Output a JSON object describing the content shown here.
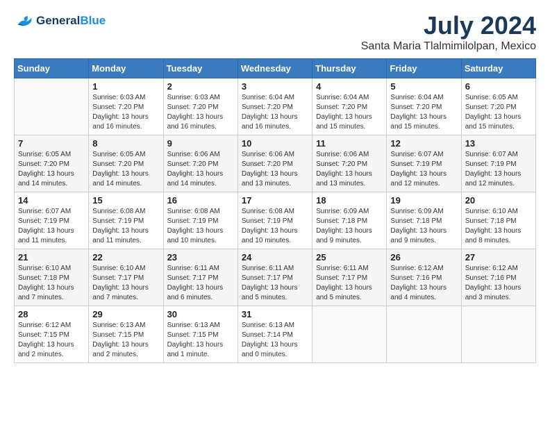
{
  "logo": {
    "line1": "General",
    "line2": "Blue"
  },
  "title": "July 2024",
  "location": "Santa Maria Tlalmimilolpan, Mexico",
  "days_header": [
    "Sunday",
    "Monday",
    "Tuesday",
    "Wednesday",
    "Thursday",
    "Friday",
    "Saturday"
  ],
  "weeks": [
    [
      {
        "day": "",
        "info": ""
      },
      {
        "day": "1",
        "info": "Sunrise: 6:03 AM\nSunset: 7:20 PM\nDaylight: 13 hours\nand 16 minutes."
      },
      {
        "day": "2",
        "info": "Sunrise: 6:03 AM\nSunset: 7:20 PM\nDaylight: 13 hours\nand 16 minutes."
      },
      {
        "day": "3",
        "info": "Sunrise: 6:04 AM\nSunset: 7:20 PM\nDaylight: 13 hours\nand 16 minutes."
      },
      {
        "day": "4",
        "info": "Sunrise: 6:04 AM\nSunset: 7:20 PM\nDaylight: 13 hours\nand 15 minutes."
      },
      {
        "day": "5",
        "info": "Sunrise: 6:04 AM\nSunset: 7:20 PM\nDaylight: 13 hours\nand 15 minutes."
      },
      {
        "day": "6",
        "info": "Sunrise: 6:05 AM\nSunset: 7:20 PM\nDaylight: 13 hours\nand 15 minutes."
      }
    ],
    [
      {
        "day": "7",
        "info": "Sunrise: 6:05 AM\nSunset: 7:20 PM\nDaylight: 13 hours\nand 14 minutes."
      },
      {
        "day": "8",
        "info": "Sunrise: 6:05 AM\nSunset: 7:20 PM\nDaylight: 13 hours\nand 14 minutes."
      },
      {
        "day": "9",
        "info": "Sunrise: 6:06 AM\nSunset: 7:20 PM\nDaylight: 13 hours\nand 14 minutes."
      },
      {
        "day": "10",
        "info": "Sunrise: 6:06 AM\nSunset: 7:20 PM\nDaylight: 13 hours\nand 13 minutes."
      },
      {
        "day": "11",
        "info": "Sunrise: 6:06 AM\nSunset: 7:20 PM\nDaylight: 13 hours\nand 13 minutes."
      },
      {
        "day": "12",
        "info": "Sunrise: 6:07 AM\nSunset: 7:19 PM\nDaylight: 13 hours\nand 12 minutes."
      },
      {
        "day": "13",
        "info": "Sunrise: 6:07 AM\nSunset: 7:19 PM\nDaylight: 13 hours\nand 12 minutes."
      }
    ],
    [
      {
        "day": "14",
        "info": "Sunrise: 6:07 AM\nSunset: 7:19 PM\nDaylight: 13 hours\nand 11 minutes."
      },
      {
        "day": "15",
        "info": "Sunrise: 6:08 AM\nSunset: 7:19 PM\nDaylight: 13 hours\nand 11 minutes."
      },
      {
        "day": "16",
        "info": "Sunrise: 6:08 AM\nSunset: 7:19 PM\nDaylight: 13 hours\nand 10 minutes."
      },
      {
        "day": "17",
        "info": "Sunrise: 6:08 AM\nSunset: 7:19 PM\nDaylight: 13 hours\nand 10 minutes."
      },
      {
        "day": "18",
        "info": "Sunrise: 6:09 AM\nSunset: 7:18 PM\nDaylight: 13 hours\nand 9 minutes."
      },
      {
        "day": "19",
        "info": "Sunrise: 6:09 AM\nSunset: 7:18 PM\nDaylight: 13 hours\nand 9 minutes."
      },
      {
        "day": "20",
        "info": "Sunrise: 6:10 AM\nSunset: 7:18 PM\nDaylight: 13 hours\nand 8 minutes."
      }
    ],
    [
      {
        "day": "21",
        "info": "Sunrise: 6:10 AM\nSunset: 7:18 PM\nDaylight: 13 hours\nand 7 minutes."
      },
      {
        "day": "22",
        "info": "Sunrise: 6:10 AM\nSunset: 7:17 PM\nDaylight: 13 hours\nand 7 minutes."
      },
      {
        "day": "23",
        "info": "Sunrise: 6:11 AM\nSunset: 7:17 PM\nDaylight: 13 hours\nand 6 minutes."
      },
      {
        "day": "24",
        "info": "Sunrise: 6:11 AM\nSunset: 7:17 PM\nDaylight: 13 hours\nand 5 minutes."
      },
      {
        "day": "25",
        "info": "Sunrise: 6:11 AM\nSunset: 7:17 PM\nDaylight: 13 hours\nand 5 minutes."
      },
      {
        "day": "26",
        "info": "Sunrise: 6:12 AM\nSunset: 7:16 PM\nDaylight: 13 hours\nand 4 minutes."
      },
      {
        "day": "27",
        "info": "Sunrise: 6:12 AM\nSunset: 7:16 PM\nDaylight: 13 hours\nand 3 minutes."
      }
    ],
    [
      {
        "day": "28",
        "info": "Sunrise: 6:12 AM\nSunset: 7:15 PM\nDaylight: 13 hours\nand 2 minutes."
      },
      {
        "day": "29",
        "info": "Sunrise: 6:13 AM\nSunset: 7:15 PM\nDaylight: 13 hours\nand 2 minutes."
      },
      {
        "day": "30",
        "info": "Sunrise: 6:13 AM\nSunset: 7:15 PM\nDaylight: 13 hours\nand 1 minute."
      },
      {
        "day": "31",
        "info": "Sunrise: 6:13 AM\nSunset: 7:14 PM\nDaylight: 13 hours\nand 0 minutes."
      },
      {
        "day": "",
        "info": ""
      },
      {
        "day": "",
        "info": ""
      },
      {
        "day": "",
        "info": ""
      }
    ]
  ]
}
